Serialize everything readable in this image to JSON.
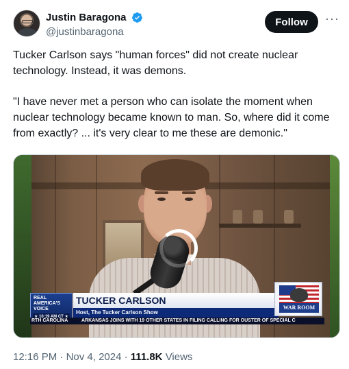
{
  "author": {
    "display_name": "Justin Baragona",
    "handle": "@justinbaragona",
    "verified": true,
    "verified_color": "#1d9bf0"
  },
  "actions": {
    "follow_label": "Follow",
    "more_icon": "more-horizontal-icon"
  },
  "tweet": {
    "paragraphs": [
      "Tucker Carlson says \"human forces\" did not create nuclear technology. Instead, it was demons.",
      "\"I have never met a person who can isolate the moment when nuclear technology became known to man. So, where did it come from exactly? ... it's very clear to me these are demonic.\""
    ]
  },
  "media": {
    "chyron": {
      "network_logo": "REAL AMERICA'S VOICE",
      "time": "10:19 AM CT",
      "name": "TUCKER CARLSON",
      "title": "Host, The Tucker Carlson Show",
      "ticker": [
        "RTH CAROLINA",
        "ARKANSAS JOINS WITH 19 OTHER STATES IN FILING CALLING FOR OUSTER OF SPECIAL C"
      ],
      "show_logo": "WAR ROOM"
    },
    "loading_indicator": "spinner"
  },
  "meta": {
    "time": "12:16 PM",
    "separator": "·",
    "date": "Nov 4, 2024",
    "views_count": "111.8K",
    "views_label": "Views"
  },
  "colors": {
    "text_primary": "#0f1419",
    "text_secondary": "#536471",
    "follow_bg": "#0f1419"
  }
}
